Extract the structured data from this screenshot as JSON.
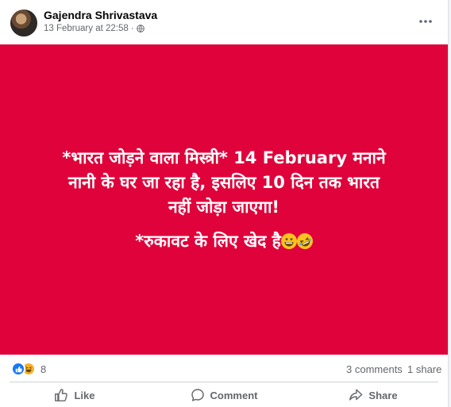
{
  "post": {
    "author": "Gajendra Shrivastava",
    "timestamp": "13 February at 22:58",
    "separator": "·",
    "audience_icon": "globe-icon",
    "more_icon": "more-options-icon",
    "avatar": "avatar"
  },
  "banner": {
    "background": "#e0023b",
    "line1": "*भारत जोड़ने वाला मिस्त्री* 14 February मनाने",
    "line2": "नानी के घर जा रहा है, इसलिए 10 दिन तक भारत",
    "line3": "नहीं जोड़ा जाएगा!",
    "line4": "*रुकावट के लिए खेद है",
    "emojis": [
      "grinning-face-emoji",
      "rolling-laughing-emoji"
    ]
  },
  "stats": {
    "reactions": [
      "like-reaction-icon",
      "haha-reaction-icon"
    ],
    "reaction_count": "8",
    "comments": "3 comments",
    "shares": "1 share"
  },
  "actions": {
    "like": "Like",
    "comment": "Comment",
    "share": "Share"
  },
  "colors": {
    "accent": "#1877f2",
    "muted_text": "#65676b"
  }
}
